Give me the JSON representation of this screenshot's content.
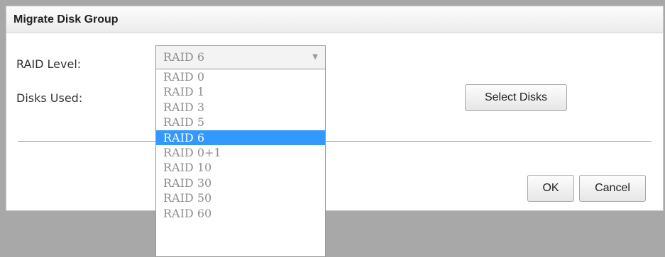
{
  "dialog": {
    "title": "Migrate Disk Group",
    "raid_level_label": "RAID Level:",
    "disks_used_label": "Disks Used:",
    "select_disks_label": "Select Disks",
    "ok_label": "OK",
    "cancel_label": "Cancel"
  },
  "raid_select": {
    "selected": "RAID 6",
    "caret_icon": "triangle-down",
    "options": [
      "RAID 0",
      "RAID 1",
      "RAID 3",
      "RAID 5",
      "RAID 6",
      "RAID 0+1",
      "RAID 10",
      "RAID 30",
      "RAID 50",
      "RAID 60"
    ]
  },
  "colors": {
    "highlight": "#3399ff",
    "overlay": "#a8a8a8"
  }
}
